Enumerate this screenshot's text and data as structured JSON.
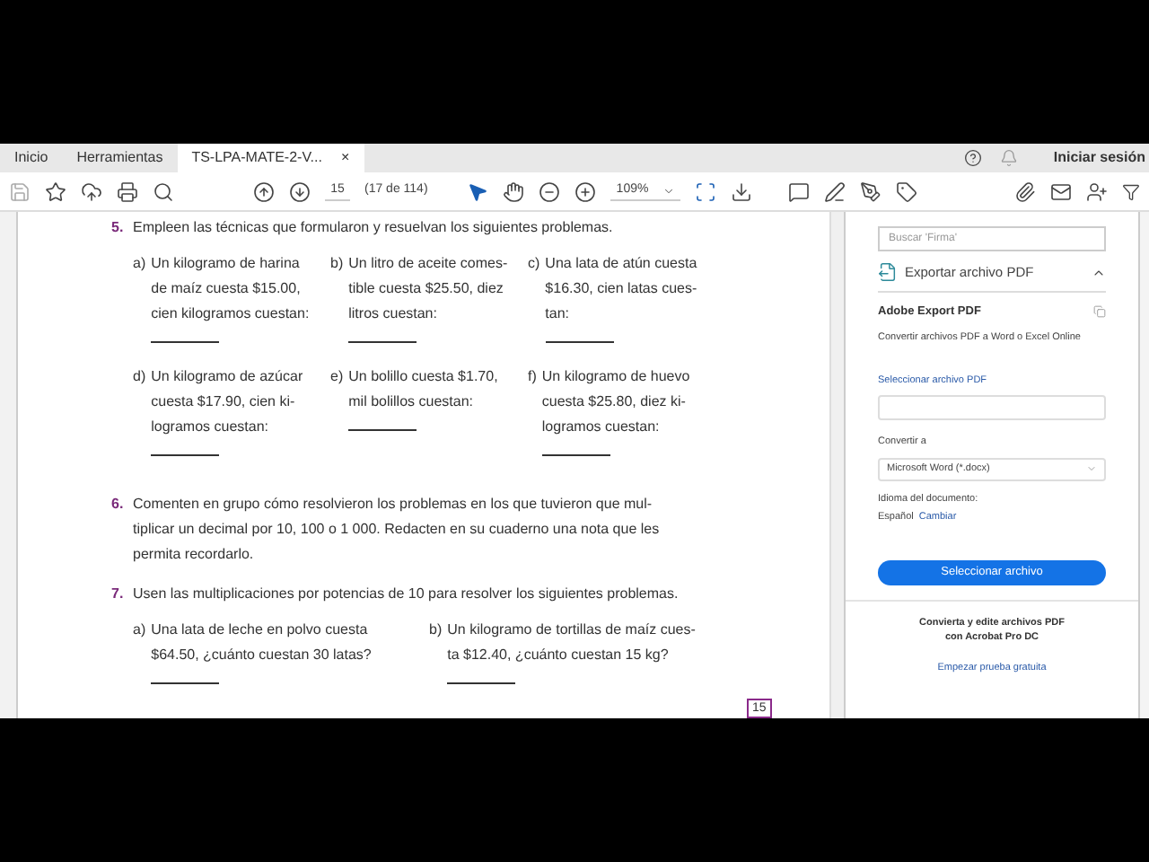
{
  "tabs": [
    {
      "label": "Inicio",
      "selected": false
    },
    {
      "label": "Herramientas",
      "selected": false
    },
    {
      "label": "TS-LPA-MATE-2-V...",
      "selected": true
    }
  ],
  "close_glyph": "×",
  "sign_in": "Iniciar sesión",
  "toolbar": {
    "page_field": "15",
    "page_count": "(17 de 114)",
    "zoom": "109%"
  },
  "document": {
    "problems": [
      {
        "number": "5.",
        "text": "Empleen las técnicas que formularon y resuelvan los siguientes problemas.",
        "kind": "three-column",
        "items": [
          {
            "letter": "a)",
            "lines": [
              "Un kilogramo de harina",
              "de maíz cuesta $15.00,",
              "cien kilogramos cuestan:"
            ]
          },
          {
            "letter": "b)",
            "lines": [
              "Un litro de aceite comes-",
              "tible cuesta $25.50, diez",
              "litros cuestan:"
            ]
          },
          {
            "letter": "c)",
            "lines": [
              "Una lata de atún cuesta",
              "$16.30, cien latas cues-",
              "tan:"
            ]
          },
          {
            "letter": "d)",
            "lines": [
              "Un kilogramo de azúcar",
              "cuesta $17.90, cien ki-",
              "logramos cuestan:"
            ]
          },
          {
            "letter": "e)",
            "lines": [
              "Un bolillo cuesta $1.70,",
              "mil bolillos cuestan:"
            ]
          },
          {
            "letter": "f)",
            "lines": [
              "Un kilogramo de huevo",
              "cuesta $25.80, diez ki-",
              "logramos cuestan:"
            ]
          }
        ]
      },
      {
        "number": "6.",
        "lines": [
          "Comenten en grupo cómo resolvieron los problemas en los que tuvieron que mul-",
          "tiplicar un decimal por 10, 100 o 1 000. Redacten en su cuaderno una nota que les",
          "permita recordarlo."
        ],
        "kind": "paragraph"
      },
      {
        "number": "7.",
        "text": "Usen las multiplicaciones por potencias de 10 para resolver los siguientes problemas.",
        "kind": "two-column",
        "items": [
          {
            "letter": "a)",
            "lines": [
              "Una lata de leche en polvo cuesta",
              "$64.50, ¿cuánto cuestan 30 latas?"
            ]
          },
          {
            "letter": "b)",
            "lines": [
              "Un kilogramo de tortillas de maíz cues-",
              "ta $12.40, ¿cuánto cuestan 15 kg?"
            ]
          }
        ]
      }
    ],
    "page_number": "15"
  },
  "panel": {
    "search_placeholder": "Buscar 'Firma'",
    "section": {
      "title": "Exportar archivo PDF",
      "expanded": true
    },
    "heading": "Adobe Export PDF",
    "description": "Convertir archivos PDF a Word o Excel Online",
    "file_label": "Seleccionar archivo PDF",
    "convert_label": "Convertir a",
    "convert_value": "Microsoft Word (*.docx)",
    "language_label": "Idioma del documento:",
    "language": "Español",
    "change_link": "Cambiar",
    "button": "Seleccionar archivo",
    "promo": [
      "Convierta y edite archivos PDF",
      "con Acrobat Pro DC"
    ],
    "trial_link": "Empezar prueba gratuita"
  }
}
